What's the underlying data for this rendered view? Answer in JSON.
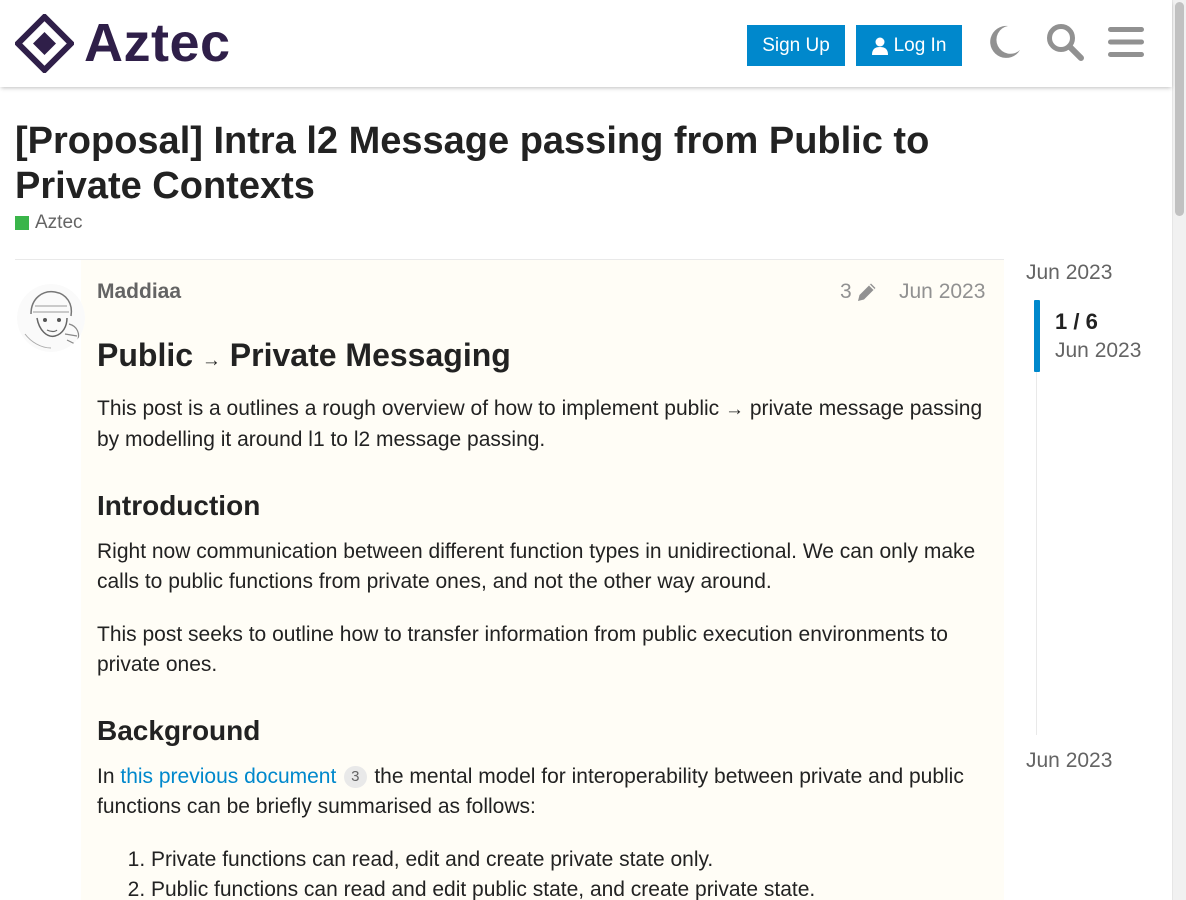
{
  "header": {
    "logo_text": "Aztec",
    "signup_label": "Sign Up",
    "login_label": "Log In",
    "icons": [
      "moon-icon",
      "search-icon",
      "hamburger-menu-icon"
    ],
    "brand_color": "#2f1f49",
    "accent_color": "#0088cc"
  },
  "topic": {
    "title": "[Proposal] Intra l2 Message passing from Public to Private Contexts",
    "category": "Aztec",
    "category_color": "#3ab54a"
  },
  "post": {
    "username": "Maddiaa",
    "edit_count": "3",
    "date": "Jun 2023",
    "h1_part1": "Public",
    "h1_arrow": "→",
    "h1_part2": "Private Messaging",
    "intro_text_1": "This post is a outlines a rough overview of how to implement public",
    "intro_arrow": "→",
    "intro_text_2": "private message passing by modelling it around l1 to l2 message passing.",
    "h2_introduction": "Introduction",
    "p_introduction_1": "Right now communication between different function types in unidirectional. We can only make calls to public functions from private ones, and not the other way around.",
    "p_introduction_2": "This post seeks to outline how to transfer information from public execution environments to private ones.",
    "h2_background": "Background",
    "bg_prefix": "In",
    "bg_link": "this previous document",
    "bg_link_clicks": "3",
    "bg_suffix": "the mental model for interoperability between private and public functions can be briefly summarised as follows:",
    "list_items": [
      "Private functions can read, edit and create private state only.",
      "Public functions can read and edit public state, and create private state."
    ]
  },
  "timeline": {
    "start_date": "Jun 2023",
    "position": "1 / 6",
    "position_date": "Jun 2023",
    "end_date": "Jun 2023"
  }
}
